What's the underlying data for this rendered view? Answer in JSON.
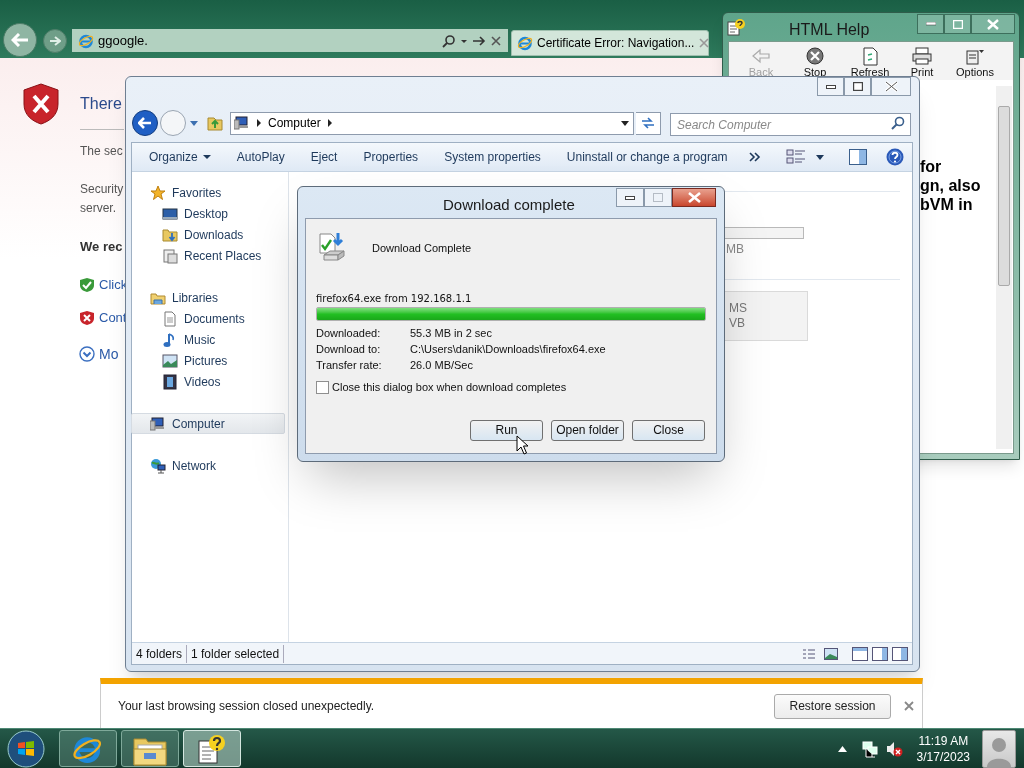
{
  "browser": {
    "address": "ggoogle.",
    "tab_title": "Certificate Error: Navigation..."
  },
  "error_page": {
    "heading": "There",
    "intro": "The sec",
    "lines": [
      "Security",
      "server."
    ],
    "recommendation": "We rec",
    "options": [
      {
        "kind": "safe",
        "label": "Click"
      },
      {
        "kind": "unsafe",
        "label": "Cont"
      },
      {
        "kind": "more",
        "label": "Mo"
      }
    ]
  },
  "help_window": {
    "title": "HTML Help",
    "toolbar": [
      {
        "kind": "back",
        "label": "Back",
        "disabled": true
      },
      {
        "kind": "stop",
        "label": "Stop",
        "disabled": false
      },
      {
        "kind": "refresh",
        "label": "Refresh",
        "disabled": false
      },
      {
        "kind": "print",
        "label": "Print",
        "disabled": false
      },
      {
        "kind": "options",
        "label": "Options",
        "disabled": false
      }
    ],
    "content_lines": [
      "for",
      "gn, also",
      "bVM in"
    ]
  },
  "explorer": {
    "address": "Computer",
    "search_placeholder": "Search Computer",
    "toolbar": [
      {
        "label": "Organize",
        "dropdown": true
      },
      {
        "label": "AutoPlay",
        "dropdown": false
      },
      {
        "label": "Eject",
        "dropdown": false
      },
      {
        "label": "Properties",
        "dropdown": false
      },
      {
        "label": "System properties",
        "dropdown": false
      },
      {
        "label": "Uninstall or change a program",
        "dropdown": false
      }
    ],
    "nav": [
      {
        "label": "Favorites",
        "kind": "favorites",
        "selected": false,
        "children": [
          {
            "label": "Desktop",
            "kind": "desktop",
            "selected": false
          },
          {
            "label": "Downloads",
            "kind": "downloads",
            "selected": false
          },
          {
            "label": "Recent Places",
            "kind": "recent",
            "selected": false
          }
        ]
      },
      {
        "label": "Libraries",
        "kind": "libraries",
        "selected": false,
        "children": [
          {
            "label": "Documents",
            "kind": "documents",
            "selected": false
          },
          {
            "label": "Music",
            "kind": "music",
            "selected": false
          },
          {
            "label": "Pictures",
            "kind": "pictures",
            "selected": false
          },
          {
            "label": "Videos",
            "kind": "videos",
            "selected": false
          }
        ]
      },
      {
        "label": "Computer",
        "kind": "computer",
        "selected": true
      },
      {
        "label": "Network",
        "kind": "network",
        "selected": false
      }
    ],
    "content": {
      "drive_size": "MB",
      "tile_lines": [
        "MS",
        "VB"
      ]
    },
    "status": [
      "4 folders",
      "1 folder selected"
    ]
  },
  "dialog": {
    "title": "Download complete",
    "heading": "Download Complete",
    "file": "firefox64.exe from 192.168.1.1",
    "level": 1,
    "details": [
      {
        "label": "Downloaded:",
        "value": "55.3 MB in 2 sec"
      },
      {
        "label": "Download to:",
        "value": "C:\\Users\\danik\\Downloads\\firefox64.exe"
      },
      {
        "label": "Transfer rate:",
        "value": "26.0 MB/Sec"
      }
    ],
    "close_option": {
      "label": "Close this dialog box when download completes",
      "checked": false
    },
    "buttons": [
      "Run",
      "Open folder",
      "Close"
    ]
  },
  "notification": {
    "message": "Your last browsing session closed unexpectedly.",
    "button": "Restore session"
  },
  "taskbar": {
    "apps": [
      {
        "kind": "ie",
        "active": false
      },
      {
        "kind": "explorer",
        "active": false
      },
      {
        "kind": "help",
        "active": true
      }
    ],
    "time": "11:19 AM",
    "date": "3/17/2023"
  }
}
